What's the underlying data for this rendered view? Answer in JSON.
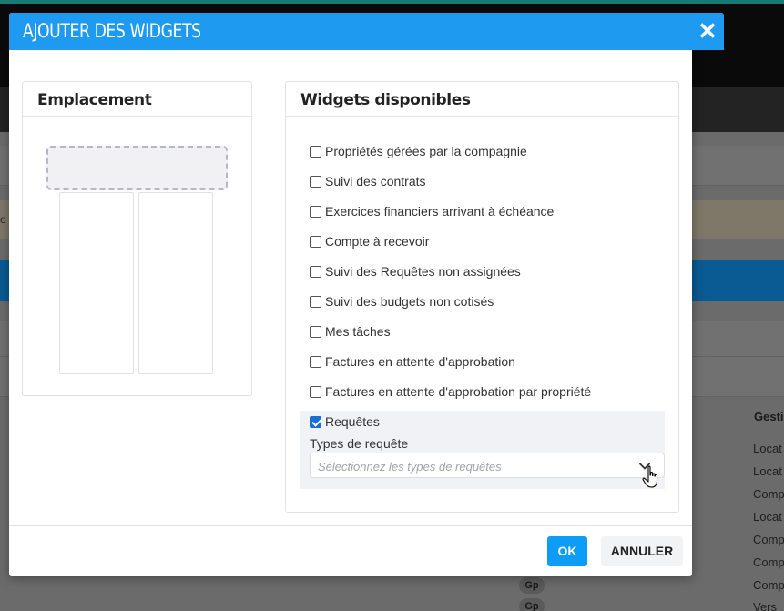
{
  "background": {
    "column_header": "Gesti",
    "cells": [
      "Locat",
      "Locat",
      "Comp",
      "Locat",
      "Comp",
      "Comp",
      "Comp",
      "Vers"
    ],
    "badges": [
      "Gp",
      "Gp"
    ],
    "left_char": "o"
  },
  "modal": {
    "title": "Ajouter des widgets",
    "close_glyph": "✕",
    "location_panel": {
      "title": "Emplacement"
    },
    "widgets_panel": {
      "title": "Widgets disponibles",
      "items": [
        {
          "label": "Propriétés gérées par la compagnie",
          "checked": false
        },
        {
          "label": "Suivi des contrats",
          "checked": false
        },
        {
          "label": "Exercices financiers arrivant à échéance",
          "checked": false
        },
        {
          "label": "Compte à recevoir",
          "checked": false
        },
        {
          "label": "Suivi des Requêtes non assignées",
          "checked": false
        },
        {
          "label": "Suivi des budgets non cotisés",
          "checked": false
        },
        {
          "label": "Mes tâches",
          "checked": false
        },
        {
          "label": "Factures en attente d'approbation",
          "checked": false
        },
        {
          "label": "Factures en attente d'approbation par propriété",
          "checked": false
        },
        {
          "label": "Requêtes",
          "checked": true
        }
      ],
      "request_types": {
        "label": "Types de requête",
        "placeholder": "Sélectionnez les types de requêtes"
      }
    },
    "footer": {
      "ok_label": "OK",
      "cancel_label": "ANNULER"
    }
  },
  "colors": {
    "header": "#1e9bf0",
    "ok_button": "#0d9cf6",
    "checkbox_checked": "#1a6ed8"
  }
}
